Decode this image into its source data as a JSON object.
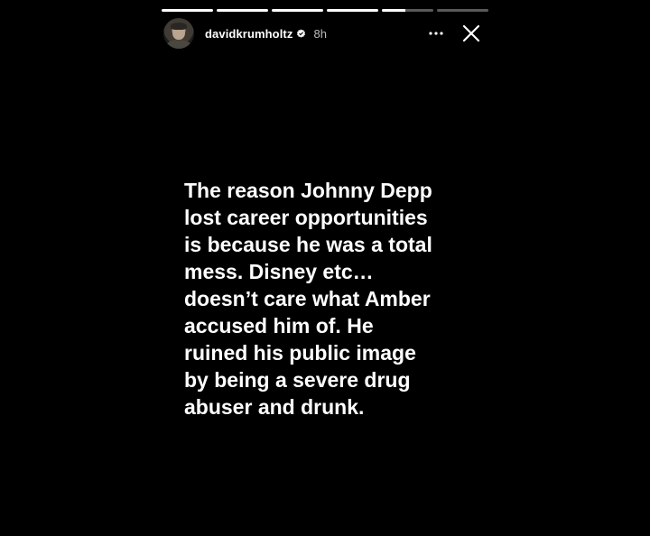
{
  "story": {
    "progress": [
      1,
      1,
      1,
      1,
      0.45,
      0
    ],
    "user": {
      "username": "davidkrumholtz",
      "verified": true,
      "time": "8h"
    },
    "icons": {
      "more": "more-dots-icon",
      "close": "close-icon",
      "verified": "verified-badge-icon"
    },
    "text_lines": [
      "The reason Johnny Depp",
      "lost career opportunities",
      "is because he was a total",
      "mess. Disney etc…",
      "doesn’t care what Amber",
      "accused him of. He",
      "ruined his public image",
      "by being a severe drug",
      "abuser and drunk."
    ]
  },
  "colors": {
    "background": "#000000",
    "text": "#ffffff",
    "time": "#bdbdbd"
  }
}
